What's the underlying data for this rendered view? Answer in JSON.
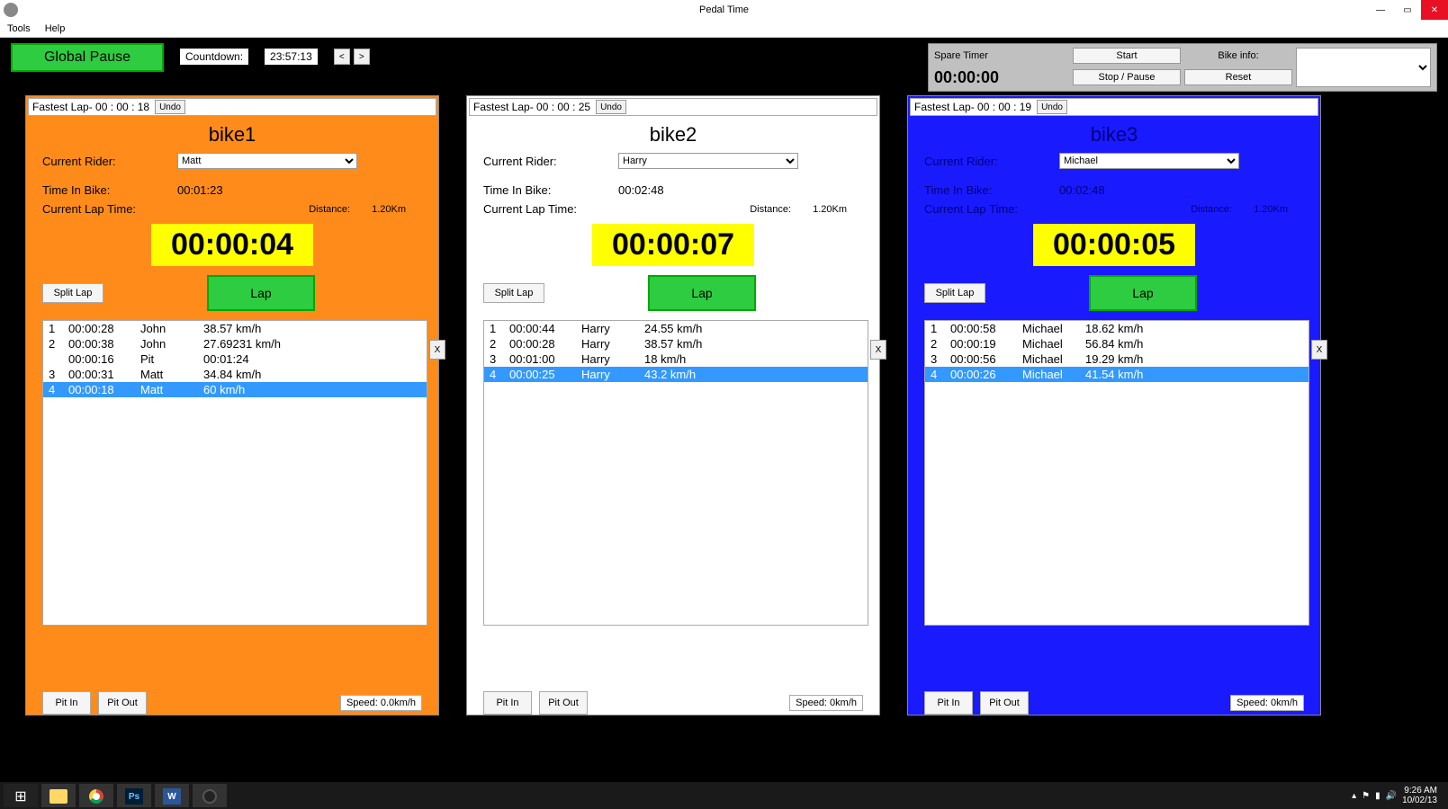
{
  "titlebar": {
    "title": "Pedal Time"
  },
  "menubar": {
    "tools": "Tools",
    "help": "Help"
  },
  "top": {
    "global_pause": "Global Pause",
    "countdown_label": "Countdown:",
    "countdown_value": "23:57:13",
    "prev": "<",
    "next": ">"
  },
  "spare": {
    "spare_timer_label": "Spare Timer",
    "spare_timer_value": "00:00:00",
    "start": "Start",
    "stop_pause": "Stop / Pause",
    "bike_info_label": "Bike info:",
    "reset": "Reset"
  },
  "buttons": {
    "undo": "Undo",
    "split_lap": "Split Lap",
    "lap": "Lap",
    "x": "X",
    "pit_in": "Pit In",
    "pit_out": "Pit Out"
  },
  "labels": {
    "current_rider": "Current Rider:",
    "time_in_bike": "Time In Bike:",
    "current_lap_time": "Current Lap Time:",
    "distance": "Distance:"
  },
  "bikes": [
    {
      "fastest": "Fastest Lap- 00 : 00 : 18",
      "name": "bike1",
      "rider": "Matt",
      "time_in_bike": "00:01:23",
      "distance": "1.20Km",
      "lap_timer": "00:00:04",
      "speed": "Speed: 0.0km/h",
      "laps": [
        {
          "n": "1",
          "t": "00:00:28",
          "r": "John",
          "s": "38.57 km/h",
          "sel": false
        },
        {
          "n": "2",
          "t": "00:00:38",
          "r": "John",
          "s": "27.69231 km/h",
          "sel": false
        },
        {
          "n": "",
          "t": "00:00:16",
          "r": "Pit",
          "s": "00:01:24",
          "sel": false
        },
        {
          "n": "3",
          "t": "00:00:31",
          "r": "Matt",
          "s": "34.84 km/h",
          "sel": false
        },
        {
          "n": "4",
          "t": "00:00:18",
          "r": "Matt",
          "s": "60 km/h",
          "sel": true
        }
      ]
    },
    {
      "fastest": "Fastest Lap-  00 : 00 : 25",
      "name": "bike2",
      "rider": "Harry",
      "time_in_bike": "00:02:48",
      "distance": "1.20Km",
      "lap_timer": "00:00:07",
      "speed": "Speed: 0km/h",
      "laps": [
        {
          "n": "1",
          "t": "00:00:44",
          "r": "Harry",
          "s": "24.55 km/h",
          "sel": false
        },
        {
          "n": "2",
          "t": "00:00:28",
          "r": "Harry",
          "s": "38.57 km/h",
          "sel": false
        },
        {
          "n": "3",
          "t": "00:01:00",
          "r": "Harry",
          "s": "18 km/h",
          "sel": false
        },
        {
          "n": "4",
          "t": "00:00:25",
          "r": "Harry",
          "s": "43.2 km/h",
          "sel": true
        }
      ]
    },
    {
      "fastest": "Fastest Lap-  00 : 00 : 19",
      "name": "bike3",
      "rider": "Michael",
      "time_in_bike": "00:02:48",
      "distance": "1.20Km",
      "lap_timer": "00:00:05",
      "speed": "Speed: 0km/h",
      "laps": [
        {
          "n": "1",
          "t": "00:00:58",
          "r": "Michael",
          "s": "18.62 km/h",
          "sel": false
        },
        {
          "n": "2",
          "t": "00:00:19",
          "r": "Michael",
          "s": "56.84 km/h",
          "sel": false
        },
        {
          "n": "3",
          "t": "00:00:56",
          "r": "Michael",
          "s": "19.29 km/h",
          "sel": false
        },
        {
          "n": "4",
          "t": "00:00:26",
          "r": "Michael",
          "s": "41.54 km/h",
          "sel": true
        }
      ]
    }
  ],
  "taskbar": {
    "time": "9:26 AM",
    "date": "10/02/13"
  }
}
